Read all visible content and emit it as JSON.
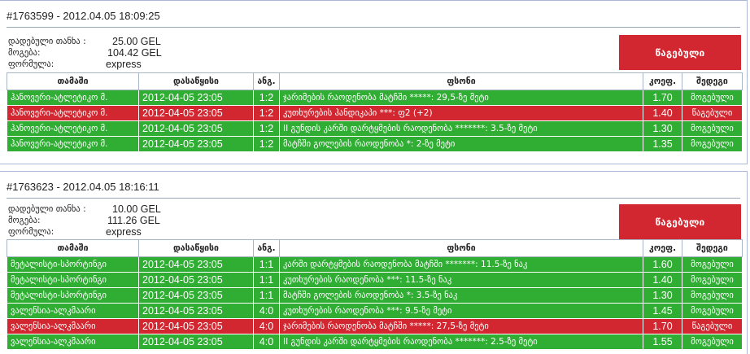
{
  "labels": {
    "stake": "დადებული თანხა :",
    "win": "მოგება:",
    "formula": "ფორმულა:"
  },
  "columns": [
    "თამაში",
    "დასაწყისი",
    "ანგ.",
    "ფსონი",
    "კოეფ.",
    "შედეგი"
  ],
  "colors": {
    "won": "#2fae33",
    "lost": "#d22730",
    "border": "#aab8d6"
  },
  "tickets": [
    {
      "header": "#1763599 - 2012.04.05 18:09:25",
      "stake": "25.00 GEL",
      "win": "104.42 GEL",
      "formula": "express",
      "status": "წაგებული",
      "rows": [
        {
          "game": "ჰანოვერი-ატლეტიკო მ.",
          "start": "2012-04-05 23:05",
          "score": "1:2",
          "bet": "ჯარიმების რაოდენობა მატჩში *****: 29,5-ზე მეტი",
          "odds": "1.70",
          "result": "მოგებული",
          "state": "won"
        },
        {
          "game": "ჰანოვერი-ატლეტიკო მ.",
          "start": "2012-04-05 23:05",
          "score": "1:2",
          "bet": "კუთხურების ჰანდიკაპი ***: ფ2 (+2)",
          "odds": "1.40",
          "result": "წაგებული",
          "state": "lost"
        },
        {
          "game": "ჰანოვერი-ატლეტიკო მ.",
          "start": "2012-04-05 23:05",
          "score": "1:2",
          "bet": "II გუნდის კარში დარტყმების რაოდენობა *******: 3.5-ზე მეტი",
          "odds": "1.30",
          "result": "მოგებული",
          "state": "won"
        },
        {
          "game": "ჰანოვერი-ატლეტიკო მ.",
          "start": "2012-04-05 23:05",
          "score": "1:2",
          "bet": "მატჩში გოლების რაოდენობა *: 2-ზე მეტი",
          "odds": "1.35",
          "result": "მოგებული",
          "state": "won"
        }
      ]
    },
    {
      "header": "#1763623 - 2012.04.05 18:16:11",
      "stake": "10.00 GEL",
      "win": "111.26 GEL",
      "formula": "express",
      "status": "წაგებული",
      "rows": [
        {
          "game": "მეტალისტი-სპორტინგი",
          "start": "2012-04-05 23:05",
          "score": "1:1",
          "bet": "კარში დარტყმების რაოდენობა მატჩში *******: 11.5-ზე ნაკ",
          "odds": "1.60",
          "result": "მოგებული",
          "state": "won"
        },
        {
          "game": "მეტალისტი-სპორტინგი",
          "start": "2012-04-05 23:05",
          "score": "1:1",
          "bet": "კუთხურების რაოდენობა ***: 11.5-ზე ნაკ",
          "odds": "1.40",
          "result": "მოგებული",
          "state": "won"
        },
        {
          "game": "მეტალისტი-სპორტინგი",
          "start": "2012-04-05 23:05",
          "score": "1:1",
          "bet": "მატჩში გოლების რაოდენობა *: 3.5-ზე ნაკ",
          "odds": "1.30",
          "result": "მოგებული",
          "state": "won"
        },
        {
          "game": "ვალენსია-ალკმაარი",
          "start": "2012-04-05 23:05",
          "score": "4:0",
          "bet": "კუთხურების რაოდენობა ***: 9.5-ზე მეტი",
          "odds": "1.45",
          "result": "მოგებული",
          "state": "won"
        },
        {
          "game": "ვალენსია-ალკმაარი",
          "start": "2012-04-05 23:05",
          "score": "4:0",
          "bet": "ჯარიმების რაოდენობა მატჩში *****: 27,5-ზე მეტი",
          "odds": "1.70",
          "result": "წაგებული",
          "state": "lost"
        },
        {
          "game": "ვალენსია-ალკმაარი",
          "start": "2012-04-05 23:05",
          "score": "4:0",
          "bet": "II გუნდის კარში დარტყმების რაოდენობა *******: 2.5-ზე მეტი",
          "odds": "1.55",
          "result": "მოგებული",
          "state": "won"
        }
      ]
    }
  ]
}
